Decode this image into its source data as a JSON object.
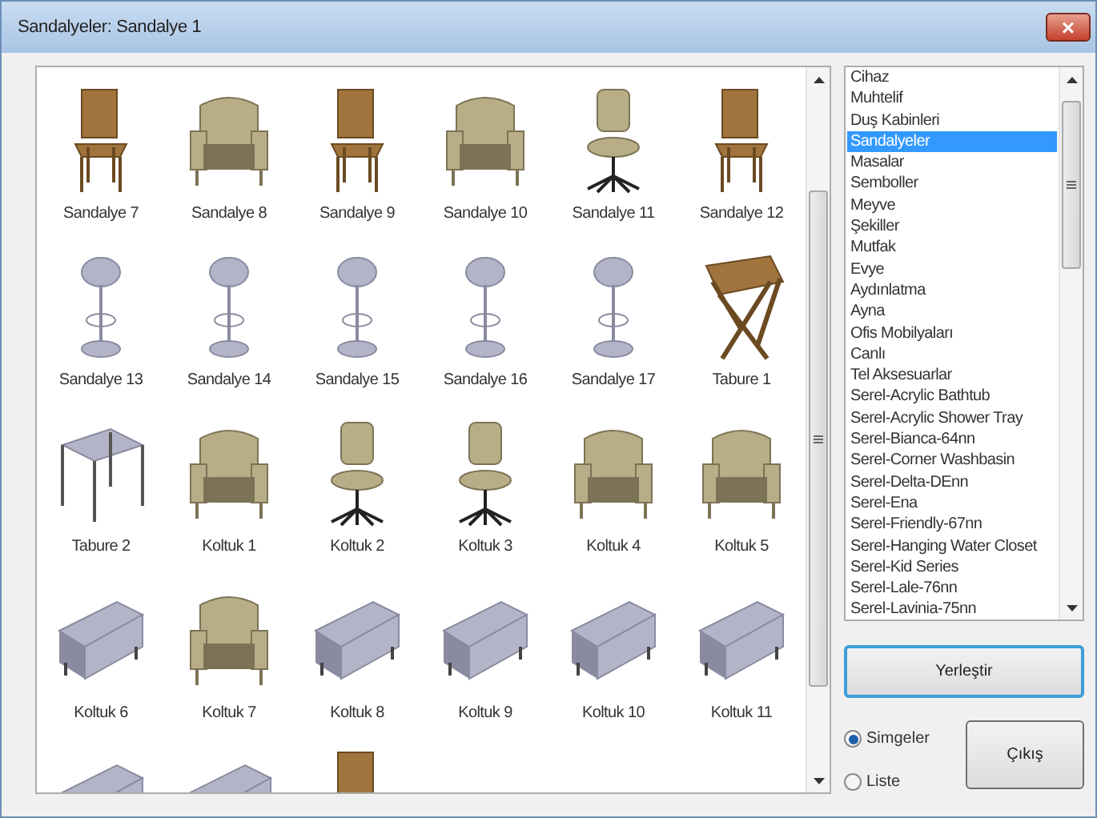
{
  "window": {
    "title": "Sandalyeler: Sandalye 1",
    "close_glyph": "×"
  },
  "items": [
    {
      "label": "Sandalye 7",
      "kind": "chair"
    },
    {
      "label": "Sandalye 8",
      "kind": "armchair"
    },
    {
      "label": "Sandalye 9",
      "kind": "chair"
    },
    {
      "label": "Sandalye 10",
      "kind": "armchair"
    },
    {
      "label": "Sandalye 11",
      "kind": "office"
    },
    {
      "label": "Sandalye 12",
      "kind": "chair"
    },
    {
      "label": "Sandalye 13",
      "kind": "barstool"
    },
    {
      "label": "Sandalye 14",
      "kind": "barstool"
    },
    {
      "label": "Sandalye 15",
      "kind": "barstool"
    },
    {
      "label": "Sandalye 16",
      "kind": "barstool"
    },
    {
      "label": "Sandalye 17",
      "kind": "barstool"
    },
    {
      "label": "Tabure 1",
      "kind": "stool"
    },
    {
      "label": "Tabure 2",
      "kind": "table"
    },
    {
      "label": "Koltuk 1",
      "kind": "armchair"
    },
    {
      "label": "Koltuk 2",
      "kind": "office"
    },
    {
      "label": "Koltuk 3",
      "kind": "office"
    },
    {
      "label": "Koltuk 4",
      "kind": "armchair"
    },
    {
      "label": "Koltuk 5",
      "kind": "armchair"
    },
    {
      "label": "Koltuk 6",
      "kind": "sofa"
    },
    {
      "label": "Koltuk 7",
      "kind": "armchair"
    },
    {
      "label": "Koltuk 8",
      "kind": "sofa"
    },
    {
      "label": "Koltuk 9",
      "kind": "sofa"
    },
    {
      "label": "Koltuk 10",
      "kind": "sofa"
    },
    {
      "label": "Koltuk 11",
      "kind": "sofa"
    },
    {
      "kind": "sofa"
    },
    {
      "kind": "sofa"
    },
    {
      "kind": "chair"
    }
  ],
  "categories": [
    {
      "label": "Cihaz",
      "selected": false
    },
    {
      "label": "Muhtelif",
      "selected": false
    },
    {
      "label": "Duş Kabinleri",
      "selected": false
    },
    {
      "label": "Sandalyeler",
      "selected": true
    },
    {
      "label": "Masalar",
      "selected": false
    },
    {
      "label": "Semboller",
      "selected": false
    },
    {
      "label": "Meyve",
      "selected": false
    },
    {
      "label": "Şekiller",
      "selected": false
    },
    {
      "label": "Mutfak",
      "selected": false
    },
    {
      "label": "Evye",
      "selected": false
    },
    {
      "label": "Aydınlatma",
      "selected": false
    },
    {
      "label": "Ayna",
      "selected": false
    },
    {
      "label": "Ofis Mobilyaları",
      "selected": false
    },
    {
      "label": "Canlı",
      "selected": false
    },
    {
      "label": "Tel Aksesuarlar",
      "selected": false
    },
    {
      "label": "Serel-Acrylic Bathtub",
      "selected": false
    },
    {
      "label": "Serel-Acrylic Shower Tray",
      "selected": false
    },
    {
      "label": "Serel-Bianca-64nn",
      "selected": false
    },
    {
      "label": "Serel-Corner Washbasin",
      "selected": false
    },
    {
      "label": "Serel-Delta-DEnn",
      "selected": false
    },
    {
      "label": "Serel-Ena",
      "selected": false
    },
    {
      "label": "Serel-Friendly-67nn",
      "selected": false
    },
    {
      "label": "Serel-Hanging Water Closet",
      "selected": false
    },
    {
      "label": "Serel-Kid Series",
      "selected": false
    },
    {
      "label": "Serel-Lale-76nn",
      "selected": false
    },
    {
      "label": "Serel-Lavinia-75nn",
      "selected": false
    }
  ],
  "place_button": {
    "label": "Yerleştir",
    "focused": true
  },
  "view_options": [
    {
      "label": "Simgeler",
      "selected": true
    },
    {
      "label": "Liste",
      "selected": false
    }
  ],
  "exit_button": {
    "label": "Çıkış",
    "focused": false
  }
}
